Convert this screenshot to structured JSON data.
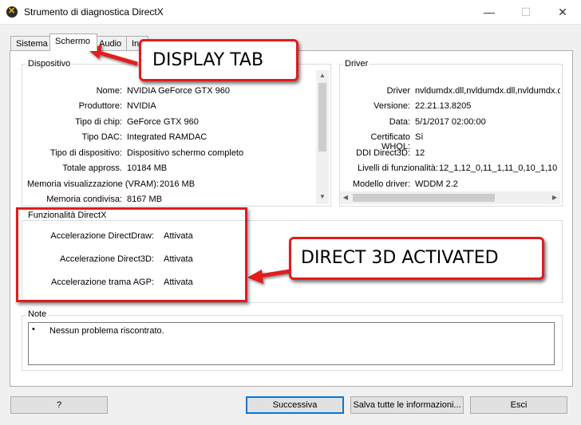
{
  "window": {
    "title": "Strumento di diagnostica DirectX",
    "min": "—",
    "max": "☐",
    "close": "✕"
  },
  "tabs": [
    {
      "label": "Sistema"
    },
    {
      "label": "Schermo"
    },
    {
      "label": "Audio"
    },
    {
      "label": "In"
    }
  ],
  "device": {
    "title": "Dispositivo",
    "rows": [
      {
        "label": "Nome:",
        "value": "NVIDIA GeForce GTX 960"
      },
      {
        "label": "Produttore:",
        "value": "NVIDIA"
      },
      {
        "label": "Tipo di chip:",
        "value": "GeForce GTX 960"
      },
      {
        "label": "Tipo DAC:",
        "value": "Integrated RAMDAC"
      },
      {
        "label": "Tipo di dispositivo:",
        "value": "Dispositivo schermo completo"
      },
      {
        "label": "Totale appross.",
        "value": "10184 MB"
      },
      {
        "label": "Memoria visualizzazione (VRAM):",
        "value": "2016 MB"
      },
      {
        "label": "Memoria condivisa:",
        "value": "8167 MB"
      }
    ]
  },
  "driver": {
    "title": "Driver",
    "rows": [
      {
        "label": "Driver",
        "value": "nvldumdx.dll,nvldumdx.dll,nvldumdx.d"
      },
      {
        "label": "Versione:",
        "value": "22.21.13.8205"
      },
      {
        "label": "Data:",
        "value": "5/1/2017 02:00:00"
      },
      {
        "label": "Certificato WHQL:",
        "value": "Sì"
      },
      {
        "label": "DDI Direct3D:",
        "value": "12"
      },
      {
        "label": "Livelli di funzionalità:",
        "value": "12_1,12_0,11_1,11_0,10_1,10"
      },
      {
        "label": "Modello driver:",
        "value": "WDDM 2.2"
      }
    ]
  },
  "directx": {
    "title": "Funzionalità DirectX",
    "rows": [
      {
        "label": "Accelerazione DirectDraw:",
        "value": "Attivata"
      },
      {
        "label": "Accelerazione Direct3D:",
        "value": "Attivata"
      },
      {
        "label": "Accelerazione trama AGP:",
        "value": "Attivata"
      }
    ]
  },
  "notes": {
    "title": "Note",
    "bullet": "•",
    "text": "Nessun problema riscontrato."
  },
  "buttons": {
    "help": "?",
    "next": "Successiva",
    "save": "Salva tutte le informazioni...",
    "exit": "Esci"
  },
  "annotations": {
    "display_tab": "DISPLAY TAB",
    "direct3d": "DIRECT 3D ACTIVATED",
    "color": "#e31b1b"
  },
  "icons": {
    "app": "directx-icon",
    "scroll_up": "▲",
    "scroll_down": "▼",
    "scroll_left": "◀",
    "scroll_right": "▶"
  }
}
